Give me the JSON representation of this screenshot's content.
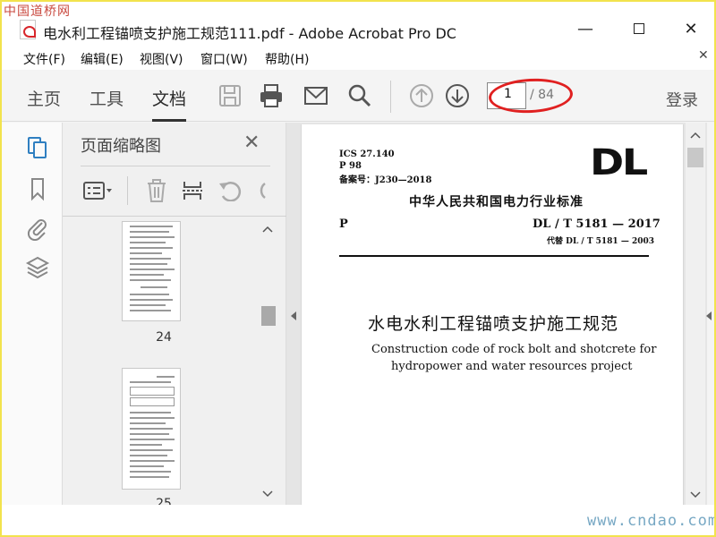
{
  "watermark_top": "中国道桥网",
  "watermark_bottom": "www.cndao.com",
  "window": {
    "title": "电水利工程锚喷支护施工规范111.pdf - Adobe Acrobat Pro DC",
    "minimize": "—",
    "close": "✕"
  },
  "menu": {
    "items": [
      "文件(F)",
      "编辑(E)",
      "视图(V)",
      "窗口(W)",
      "帮助(H)"
    ],
    "close": "✕"
  },
  "toolbar": {
    "tabs": [
      "主页",
      "工具",
      "文档"
    ],
    "active_tab": "文档",
    "icons": [
      "save-icon",
      "print-icon",
      "email-icon",
      "search-icon",
      "page-up-icon",
      "page-down-icon"
    ],
    "page_current": "1",
    "page_total": "/ 84",
    "login": "登录"
  },
  "left_strip": {
    "icons": [
      "page-thumbnails-icon",
      "bookmark-icon",
      "attachment-icon",
      "layers-icon"
    ]
  },
  "thumbnails_panel": {
    "title": "页面缩略图",
    "close": "✕",
    "tools": [
      "options-menu-icon",
      "delete-icon",
      "insert-page-icon",
      "undo-icon",
      "redo-icon"
    ],
    "pages": [
      "24",
      "25"
    ]
  },
  "document": {
    "ics": "ICS 27.140",
    "p_code": "P 98",
    "filing_no": "备案号：J230—2018",
    "logo": "DL",
    "org": "中华人民共和国电力行业标准",
    "p_label": "P",
    "std_no": "DL / T  5181 — 2017",
    "replaces": "代替 DL / T  5181 — 2003",
    "title_cn": "水电水利工程锚喷支护施工规范",
    "title_en_1": "Construction code of rock bolt and shotcrete for",
    "title_en_2": "hydropower and water resources project"
  },
  "colors": {
    "annotation_ellipse": "#e02020",
    "frame": "#f2e34d",
    "watermark_top": "#c9493f",
    "watermark_bottom": "#77a8c4"
  }
}
